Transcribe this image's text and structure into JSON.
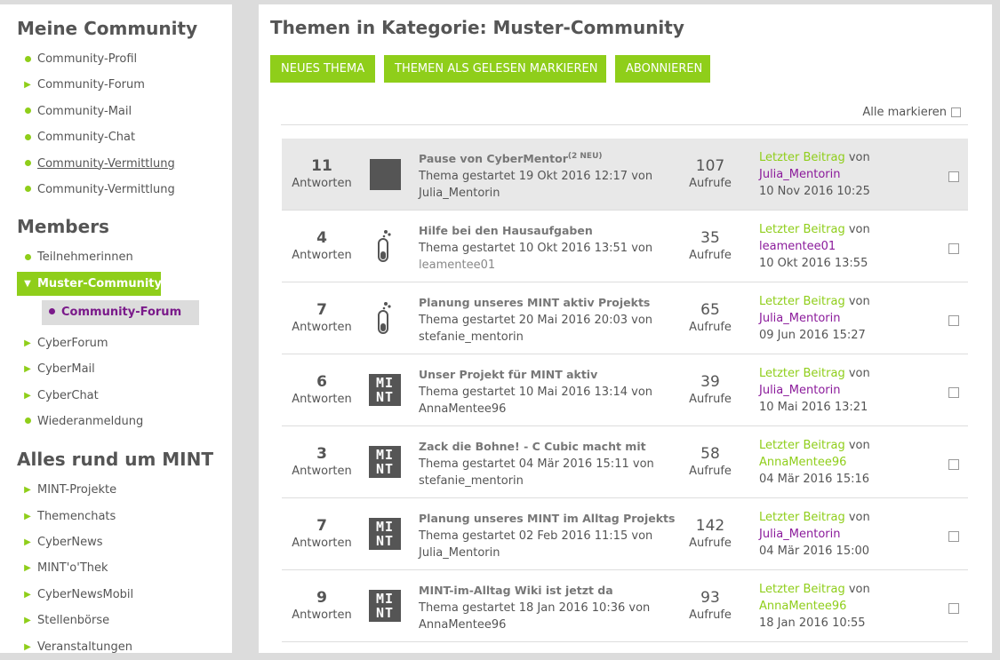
{
  "sidebar": {
    "sections": [
      {
        "heading": "Meine Community",
        "items": [
          {
            "label": "Community-Profil",
            "marker": "dot"
          },
          {
            "label": "Community-Forum",
            "marker": "arrow"
          },
          {
            "label": "Community-Mail",
            "marker": "dot"
          },
          {
            "label": "Community-Chat",
            "marker": "dot"
          },
          {
            "label": "Community-Vermittlung",
            "marker": "dot"
          },
          {
            "label": "Community-Vermittlung",
            "marker": "dot"
          }
        ]
      },
      {
        "heading": "Members",
        "items": [
          {
            "label": "Teilnehmerinnen",
            "marker": "dot"
          },
          {
            "label": "Muster-Community",
            "marker": "open-arrow"
          },
          {
            "label": "Community-Forum",
            "marker": "dot"
          },
          {
            "label": "CyberForum",
            "marker": "arrow"
          },
          {
            "label": "CyberMail",
            "marker": "arrow"
          },
          {
            "label": "CyberChat",
            "marker": "arrow"
          },
          {
            "label": "Wiederanmeldung",
            "marker": "dot"
          }
        ]
      },
      {
        "heading": "Alles rund um MINT",
        "items": [
          {
            "label": "MINT-Projekte",
            "marker": "arrow"
          },
          {
            "label": "Themenchats",
            "marker": "arrow"
          },
          {
            "label": "CyberNews",
            "marker": "arrow"
          },
          {
            "label": "MINT'o'Thek",
            "marker": "arrow"
          },
          {
            "label": "CyberNewsMobil",
            "marker": "arrow"
          },
          {
            "label": "Stellenbörse",
            "marker": "arrow"
          },
          {
            "label": "Veranstaltungen",
            "marker": "arrow"
          }
        ]
      }
    ]
  },
  "main": {
    "title": "Themen in Kategorie: Muster-Community",
    "buttons": {
      "new_topic": "Neues Thema",
      "mark_read": "Themen als gelesen markieren",
      "subscribe": "Abonnieren"
    },
    "mark_all_label": "Alle markieren",
    "replies_label": "Antworten",
    "views_label": "Aufrufe",
    "last_post_label": "Letzter Beitrag",
    "by_label": "von",
    "started_prefix": "Thema gestartet",
    "mint_icon_text": [
      "MI",
      "NT"
    ],
    "topics": [
      {
        "replies": "11",
        "icon": "square",
        "title": "Pause von CyberMentor",
        "badge": "(2 NEU)",
        "started": "19 Okt 2016 12:17",
        "starter": "Julia_Mentorin",
        "views": "107",
        "last_user": "Julia_Mentorin",
        "last_date": "10 Nov 2016 10:25"
      },
      {
        "replies": "4",
        "icon": "test-tube",
        "title": "Hilfe bei den Hausaufgaben",
        "badge": "",
        "started": "10 Okt 2016 13:51",
        "starter": "leamentee01",
        "views": "35",
        "last_user": "leamentee01",
        "last_date": "10 Okt 2016 13:55"
      },
      {
        "replies": "7",
        "icon": "test-tube",
        "title": "Planung unseres MINT aktiv Projekts",
        "badge": "",
        "started": "20 Mai 2016 20:03",
        "starter": "stefanie_mentorin",
        "views": "65",
        "last_user": "Julia_Mentorin",
        "last_date": "09 Jun 2016 15:27"
      },
      {
        "replies": "6",
        "icon": "mint",
        "title": "Unser Projekt für MINT aktiv",
        "badge": "",
        "started": "10 Mai 2016 13:14",
        "starter": "AnnaMentee96",
        "views": "39",
        "last_user": "Julia_Mentorin",
        "last_date": "10 Mai 2016 13:21"
      },
      {
        "replies": "3",
        "icon": "mint",
        "title": "Zack die Bohne! - C Cubic macht mit",
        "badge": "",
        "started": "04 Mär 2016 15:11",
        "starter": "stefanie_mentorin",
        "views": "58",
        "last_user": "AnnaMentee96",
        "last_date": "04 Mär 2016 15:16"
      },
      {
        "replies": "7",
        "icon": "mint",
        "title": "Planung unseres MINT im Alltag Projekts",
        "badge": "",
        "started": "02 Feb 2016 11:15",
        "starter": "Julia_Mentorin",
        "views": "142",
        "last_user": "Julia_Mentorin",
        "last_date": "04 Mär 2016 15:00"
      },
      {
        "replies": "9",
        "icon": "mint",
        "title": "MINT-im-Alltag Wiki ist jetzt da",
        "badge": "",
        "started": "18 Jan 2016 10:36",
        "starter": "AnnaMentee96",
        "views": "93",
        "last_user": "AnnaMentee96",
        "last_date": "18 Jan 2016 10:55"
      }
    ]
  },
  "colors": {
    "accent": "#8fce1a",
    "active_sub": "#7a1a8a",
    "user_link": "#8b1b9b"
  }
}
